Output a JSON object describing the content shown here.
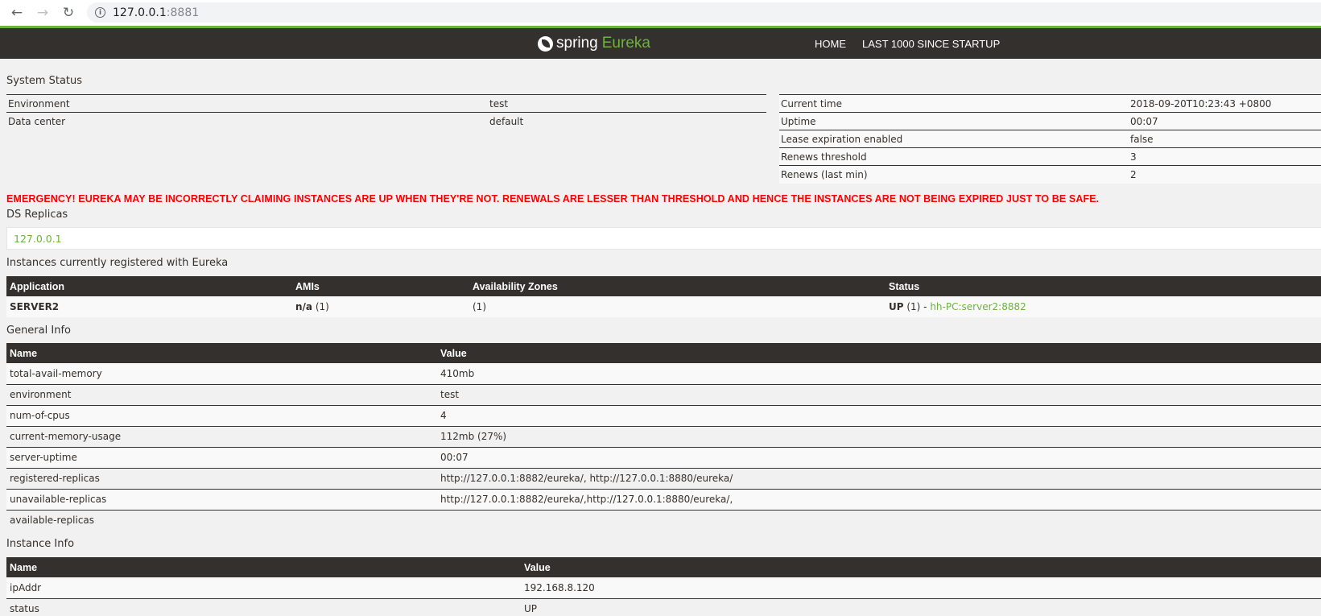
{
  "browser": {
    "host": "127.0.0.1",
    "port": ":8881"
  },
  "navbar": {
    "brand_spring": "spring",
    "brand_eureka": "Eureka",
    "home": "HOME",
    "last": "LAST 1000 SINCE STARTUP"
  },
  "system_status": {
    "title": "System Status",
    "left": [
      {
        "label": "Environment",
        "value": "test"
      },
      {
        "label": "Data center",
        "value": "default"
      }
    ],
    "right": [
      {
        "label": "Current time",
        "value": "2018-09-20T10:23:43 +0800"
      },
      {
        "label": "Uptime",
        "value": "00:07"
      },
      {
        "label": "Lease expiration enabled",
        "value": "false"
      },
      {
        "label": "Renews threshold",
        "value": "3"
      },
      {
        "label": "Renews (last min)",
        "value": "2"
      }
    ]
  },
  "emergency": "EMERGENCY! EUREKA MAY BE INCORRECTLY CLAIMING INSTANCES ARE UP WHEN THEY'RE NOT. RENEWALS ARE LESSER THAN THRESHOLD AND HENCE THE INSTANCES ARE NOT BEING EXPIRED JUST TO BE SAFE.",
  "ds_replicas": {
    "title": "DS Replicas",
    "items": [
      "127.0.0.1"
    ]
  },
  "instances": {
    "title": "Instances currently registered with Eureka",
    "headers": [
      "Application",
      "AMIs",
      "Availability Zones",
      "Status"
    ],
    "rows": [
      {
        "application": "SERVER2",
        "amis_bold": "n/a",
        "amis_count": " (1)",
        "zones": "(1)",
        "status_bold": "UP",
        "status_count": " (1) - ",
        "status_link": "hh-PC:server2:8882"
      }
    ]
  },
  "general_info": {
    "title": "General Info",
    "headers": [
      "Name",
      "Value"
    ],
    "rows": [
      {
        "name": "total-avail-memory",
        "value": "410mb"
      },
      {
        "name": "environment",
        "value": "test"
      },
      {
        "name": "num-of-cpus",
        "value": "4"
      },
      {
        "name": "current-memory-usage",
        "value": "112mb (27%)"
      },
      {
        "name": "server-uptime",
        "value": "00:07"
      },
      {
        "name": "registered-replicas",
        "value": "http://127.0.0.1:8882/eureka/, http://127.0.0.1:8880/eureka/"
      },
      {
        "name": "unavailable-replicas",
        "value": "http://127.0.0.1:8882/eureka/,http://127.0.0.1:8880/eureka/,"
      },
      {
        "name": "available-replicas",
        "value": ""
      }
    ]
  },
  "instance_info": {
    "title": "Instance Info",
    "headers": [
      "Name",
      "Value"
    ],
    "rows": [
      {
        "name": "ipAddr",
        "value": "192.168.8.120"
      },
      {
        "name": "status",
        "value": "UP"
      }
    ]
  },
  "colors": {
    "brand_green": "#6db33f",
    "dark": "#34302d",
    "emergency_red": "#ff0000"
  }
}
